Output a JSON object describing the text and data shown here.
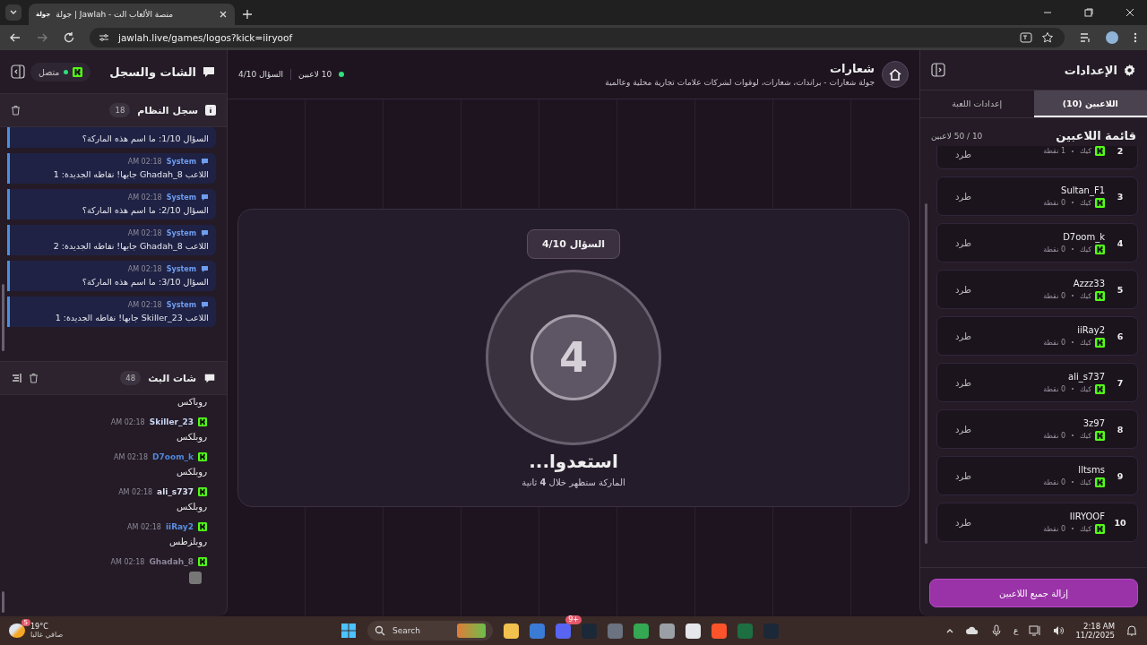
{
  "browser": {
    "tab": {
      "favicon_text": "جولة",
      "title": "جولة | Jawlah - منصة الألعاب الت"
    },
    "url": "jawlah.live/games/logos?kick=iiryoof"
  },
  "chat_panel": {
    "title": "الشات والسجل",
    "status": {
      "label": "متصل",
      "connected": true
    },
    "system_log": {
      "title": "سجل النظام",
      "count": "18",
      "entries": [
        {
          "text": "السؤال 1/10: ما اسم هذه الماركة؟"
        },
        {
          "sender": "System",
          "time": "02:18 AM",
          "text": "اللاعب Ghadah_8 جابها! نقاطه الجديدة: 1"
        },
        {
          "sender": "System",
          "time": "02:18 AM",
          "text": "السؤال 2/10: ما اسم هذه الماركة؟"
        },
        {
          "sender": "System",
          "time": "02:18 AM",
          "text": "اللاعب Ghadah_8 جابها! نقاطه الجديدة: 2"
        },
        {
          "sender": "System",
          "time": "02:18 AM",
          "text": "السؤال 3/10: ما اسم هذه الماركة؟"
        },
        {
          "sender": "System",
          "time": "02:18 AM",
          "text": "اللاعب Skiller_23 جابها! نقاطه الجديدة: 1"
        }
      ]
    },
    "stream_chat": {
      "title": "شات البث",
      "count": "48",
      "messages": [
        {
          "kind": "text",
          "text": "روباكس"
        },
        {
          "kind": "message",
          "user": "Skiller_23",
          "color": "#c8d3f2",
          "time": "02:18 AM",
          "text": "روبلكس"
        },
        {
          "kind": "message",
          "user": "D7oom_k",
          "color": "#4f86d9",
          "time": "02:18 AM",
          "text": "روبلكس"
        },
        {
          "kind": "message",
          "user": "ali_s737",
          "color": "#d9def0",
          "time": "02:18 AM",
          "text": "روبلكس"
        },
        {
          "kind": "message",
          "user": "iiRay2",
          "color": "#5a8fe0",
          "time": "02:18 AM",
          "text": "روبلزطس"
        },
        {
          "kind": "sticker",
          "user": "Ghadah_8",
          "color": "#8c8598",
          "time": "02:18 AM"
        }
      ]
    }
  },
  "game": {
    "title": "شعارات",
    "subtitle": "جولة شعارات - براندات، شعارات، لوقوات لشركات علامات تجارية محلية وعالمية",
    "players": "10 لاعبين",
    "question": "السؤال 4/10",
    "card": {
      "question": "السؤال 4/10",
      "countdown": "4",
      "heading": "استعدوا...",
      "note": "الماركة ستظهر خلال **4** ثانية"
    }
  },
  "settings": {
    "title": "الإعدادات",
    "tabs": [
      {
        "label": "اللاعبين (10)",
        "selected": true
      },
      {
        "label": "إعدادات اللعبة",
        "selected": false
      }
    ],
    "list_title": "قائمة اللاعبين",
    "capacity": "10 / 50 لاعبين",
    "players": [
      {
        "rank": "2",
        "platform": "كيك",
        "points": "1 نقطة",
        "action": "طرد"
      },
      {
        "rank": "3",
        "name": "Sultan_F1",
        "platform": "كيك",
        "points": "0 نقطة",
        "action": "طرد"
      },
      {
        "rank": "4",
        "name": "D7oom_k",
        "platform": "كيك",
        "points": "0 نقطة",
        "action": "طرد"
      },
      {
        "rank": "5",
        "name": "Azzz33",
        "platform": "كيك",
        "points": "0 نقطة",
        "action": "طرد"
      },
      {
        "rank": "6",
        "name": "iiRay2",
        "platform": "كيك",
        "points": "0 نقطة",
        "action": "طرد"
      },
      {
        "rank": "7",
        "name": "ali_s737",
        "platform": "كيك",
        "points": "0 نقطة",
        "action": "طرد"
      },
      {
        "rank": "8",
        "name": "3z97",
        "platform": "كيك",
        "points": "0 نقطة",
        "action": "طرد"
      },
      {
        "rank": "9",
        "name": "lltsms",
        "platform": "كيك",
        "points": "0 نقطة",
        "action": "طرد"
      },
      {
        "rank": "10",
        "name": "IIRYOOF",
        "platform": "كيك",
        "points": "0 نقطة",
        "action": "طرد"
      }
    ],
    "remove_all": "إزالة جميع اللاعبين"
  },
  "taskbar": {
    "weather": {
      "temp": "19°C",
      "desc": "صافي غالبا",
      "badge": "5"
    },
    "search": "Search",
    "apps": [
      {
        "kind": "files"
      },
      {
        "kind": "store"
      },
      {
        "kind": "chat",
        "badge": "9+"
      },
      {
        "kind": "steam"
      },
      {
        "kind": "settings"
      },
      {
        "kind": "chrome"
      },
      {
        "kind": "line"
      },
      {
        "kind": "github"
      },
      {
        "kind": "brave"
      },
      {
        "kind": "excel"
      },
      {
        "kind": "steam"
      }
    ],
    "lang": "ع",
    "time": "2:18 AM",
    "date": "11/2/2025"
  }
}
